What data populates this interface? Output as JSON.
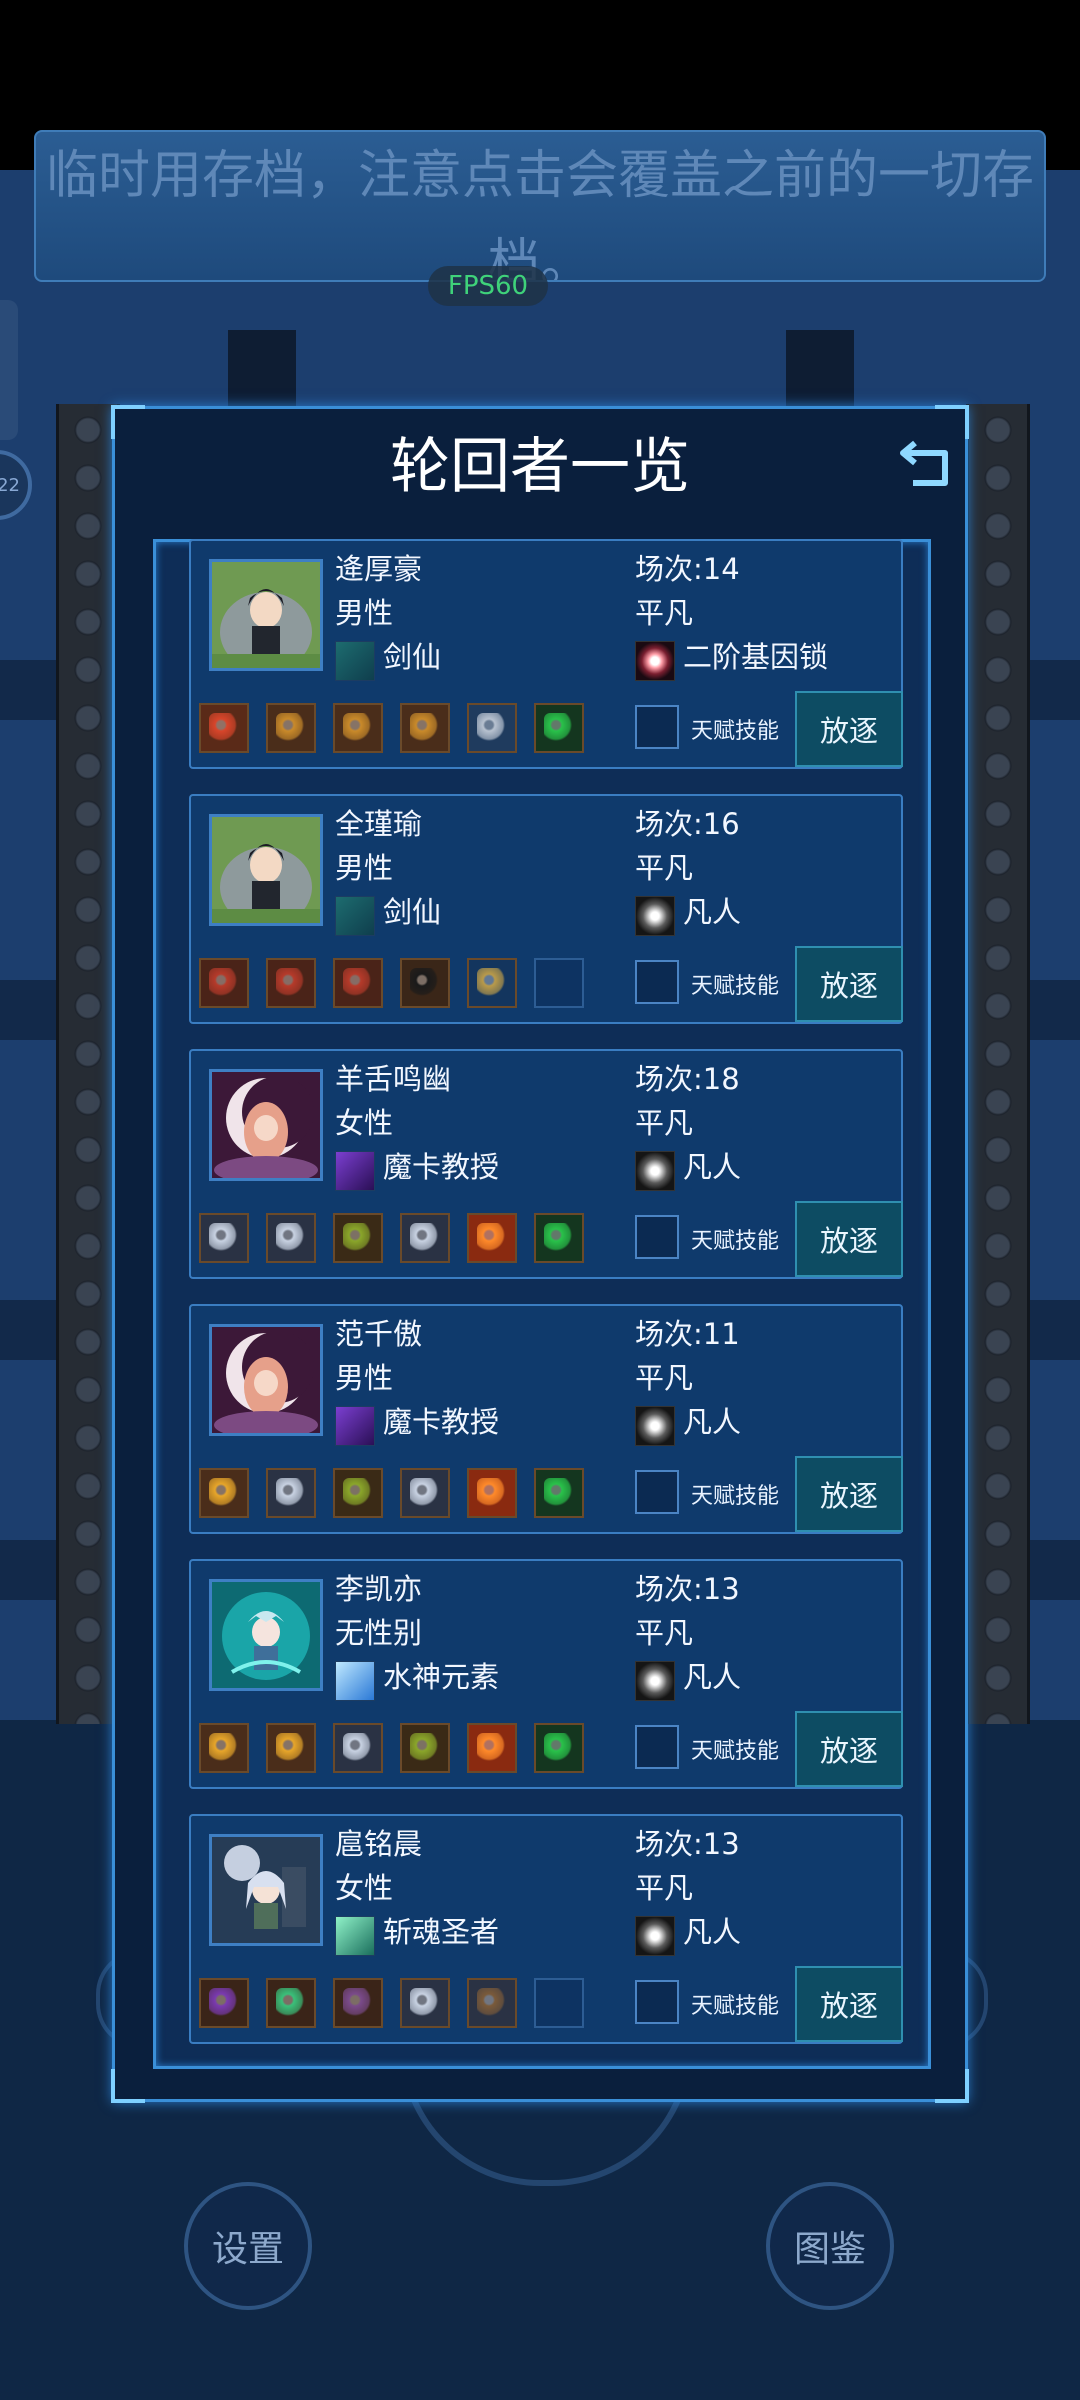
{
  "notice": {
    "text": "临时用存档，注意点击会覆盖之前的一切存档。"
  },
  "fps": {
    "label": "FPS60"
  },
  "left_badge": {
    "text": "22"
  },
  "panel": {
    "title": "轮回者一览"
  },
  "labels": {
    "talent": "天赋技能",
    "exile": "放逐"
  },
  "bottom_nav": {
    "settings": "设置",
    "codex": "图鉴"
  },
  "colors": {
    "accent": "#3a8fd8",
    "card_bg": "#0f3a6c",
    "exile_bg": "#0d4c63"
  },
  "characters": [
    {
      "name": "逄厚豪",
      "gender": "男性",
      "class_name": "剑仙",
      "class_icon": "sword-icon",
      "avatar": "swordsman-portrait",
      "rounds": "场次:14",
      "rank": "平凡",
      "power": "二阶基因锁",
      "power_icon": "gene-lock-icon",
      "items": [
        "red-crystal",
        "gold-ore",
        "gold-ore",
        "gold-ore",
        "robot-part",
        "green-rune"
      ]
    },
    {
      "name": "全瑾瑜",
      "gender": "男性",
      "class_name": "剑仙",
      "class_icon": "sword-icon",
      "avatar": "swordsman-portrait",
      "rounds": "场次:16",
      "rank": "平凡",
      "power": "凡人",
      "power_icon": "mortal-icon",
      "items": [
        "red-ore",
        "red-ore",
        "red-ore",
        "goggles",
        "stick",
        "empty"
      ]
    },
    {
      "name": "羊舌鸣幽",
      "gender": "女性",
      "class_name": "魔卡教授",
      "class_icon": "magic-card-icon",
      "avatar": "moon-mage-portrait",
      "rounds": "场次:18",
      "rank": "平凡",
      "power": "凡人",
      "power_icon": "mortal-icon",
      "items": [
        "book",
        "book",
        "herb",
        "book",
        "fire-orb",
        "green-rune"
      ]
    },
    {
      "name": "范千傲",
      "gender": "男性",
      "class_name": "魔卡教授",
      "class_icon": "magic-card-icon",
      "avatar": "moon-mage-portrait",
      "rounds": "场次:11",
      "rank": "平凡",
      "power": "凡人",
      "power_icon": "mortal-icon",
      "items": [
        "gold-gem",
        "book",
        "herb",
        "book",
        "fire-orb",
        "green-rune"
      ]
    },
    {
      "name": "李凯亦",
      "gender": "无性别",
      "class_name": "水神元素",
      "class_icon": "water-elemental-icon",
      "avatar": "water-spirit-portrait",
      "rounds": "场次:13",
      "rank": "平凡",
      "power": "凡人",
      "power_icon": "mortal-icon",
      "items": [
        "gold-gem",
        "gold-gem",
        "book",
        "herb",
        "fire-orb",
        "green-rune"
      ]
    },
    {
      "name": "扈铭晨",
      "gender": "女性",
      "class_name": "斩魂圣者",
      "class_icon": "soul-saint-icon",
      "avatar": "silver-knight-portrait",
      "rounds": "场次:13",
      "rank": "平凡",
      "power": "凡人",
      "power_icon": "mortal-icon",
      "items": [
        "purple-crystal",
        "green-crystal",
        "purple-ore",
        "book",
        "backpack",
        "empty"
      ]
    }
  ]
}
